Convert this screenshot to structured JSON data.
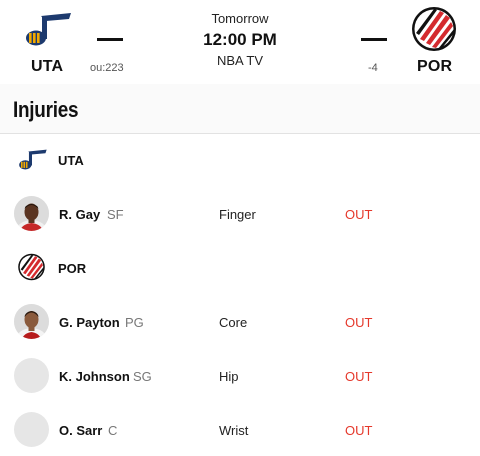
{
  "game": {
    "day": "Tomorrow",
    "time": "12:00 PM",
    "tv": "NBA TV",
    "away": {
      "abbr": "UTA",
      "score": "—",
      "line": "ou:223",
      "logo_icon": "jazz-note-icon"
    },
    "home": {
      "abbr": "POR",
      "score": "—",
      "line": "-4",
      "logo_icon": "blazers-pinwheel-icon"
    }
  },
  "injuries": {
    "title": "Injuries",
    "teams": [
      {
        "name": "UTA",
        "players": [
          {
            "name": "R. Gay",
            "position": "SF",
            "injury": "Finger",
            "status": "OUT",
            "has_photo": true
          }
        ]
      },
      {
        "name": "POR",
        "players": [
          {
            "name": "G. Payton",
            "position": "PG",
            "injury": "Core",
            "status": "OUT",
            "has_photo": true
          },
          {
            "name": "K. Johnson",
            "position": "SG",
            "injury": "Hip",
            "status": "OUT",
            "has_photo": false
          },
          {
            "name": "O. Sarr",
            "position": "C",
            "injury": "Wrist",
            "status": "OUT",
            "has_photo": false
          }
        ]
      }
    ]
  },
  "colors": {
    "status_out": "#e5382b",
    "jazz_navy": "#1d3a6e",
    "jazz_gold": "#f2a900",
    "blazers_red": "#d42a2e",
    "blazers_black": "#111111"
  }
}
